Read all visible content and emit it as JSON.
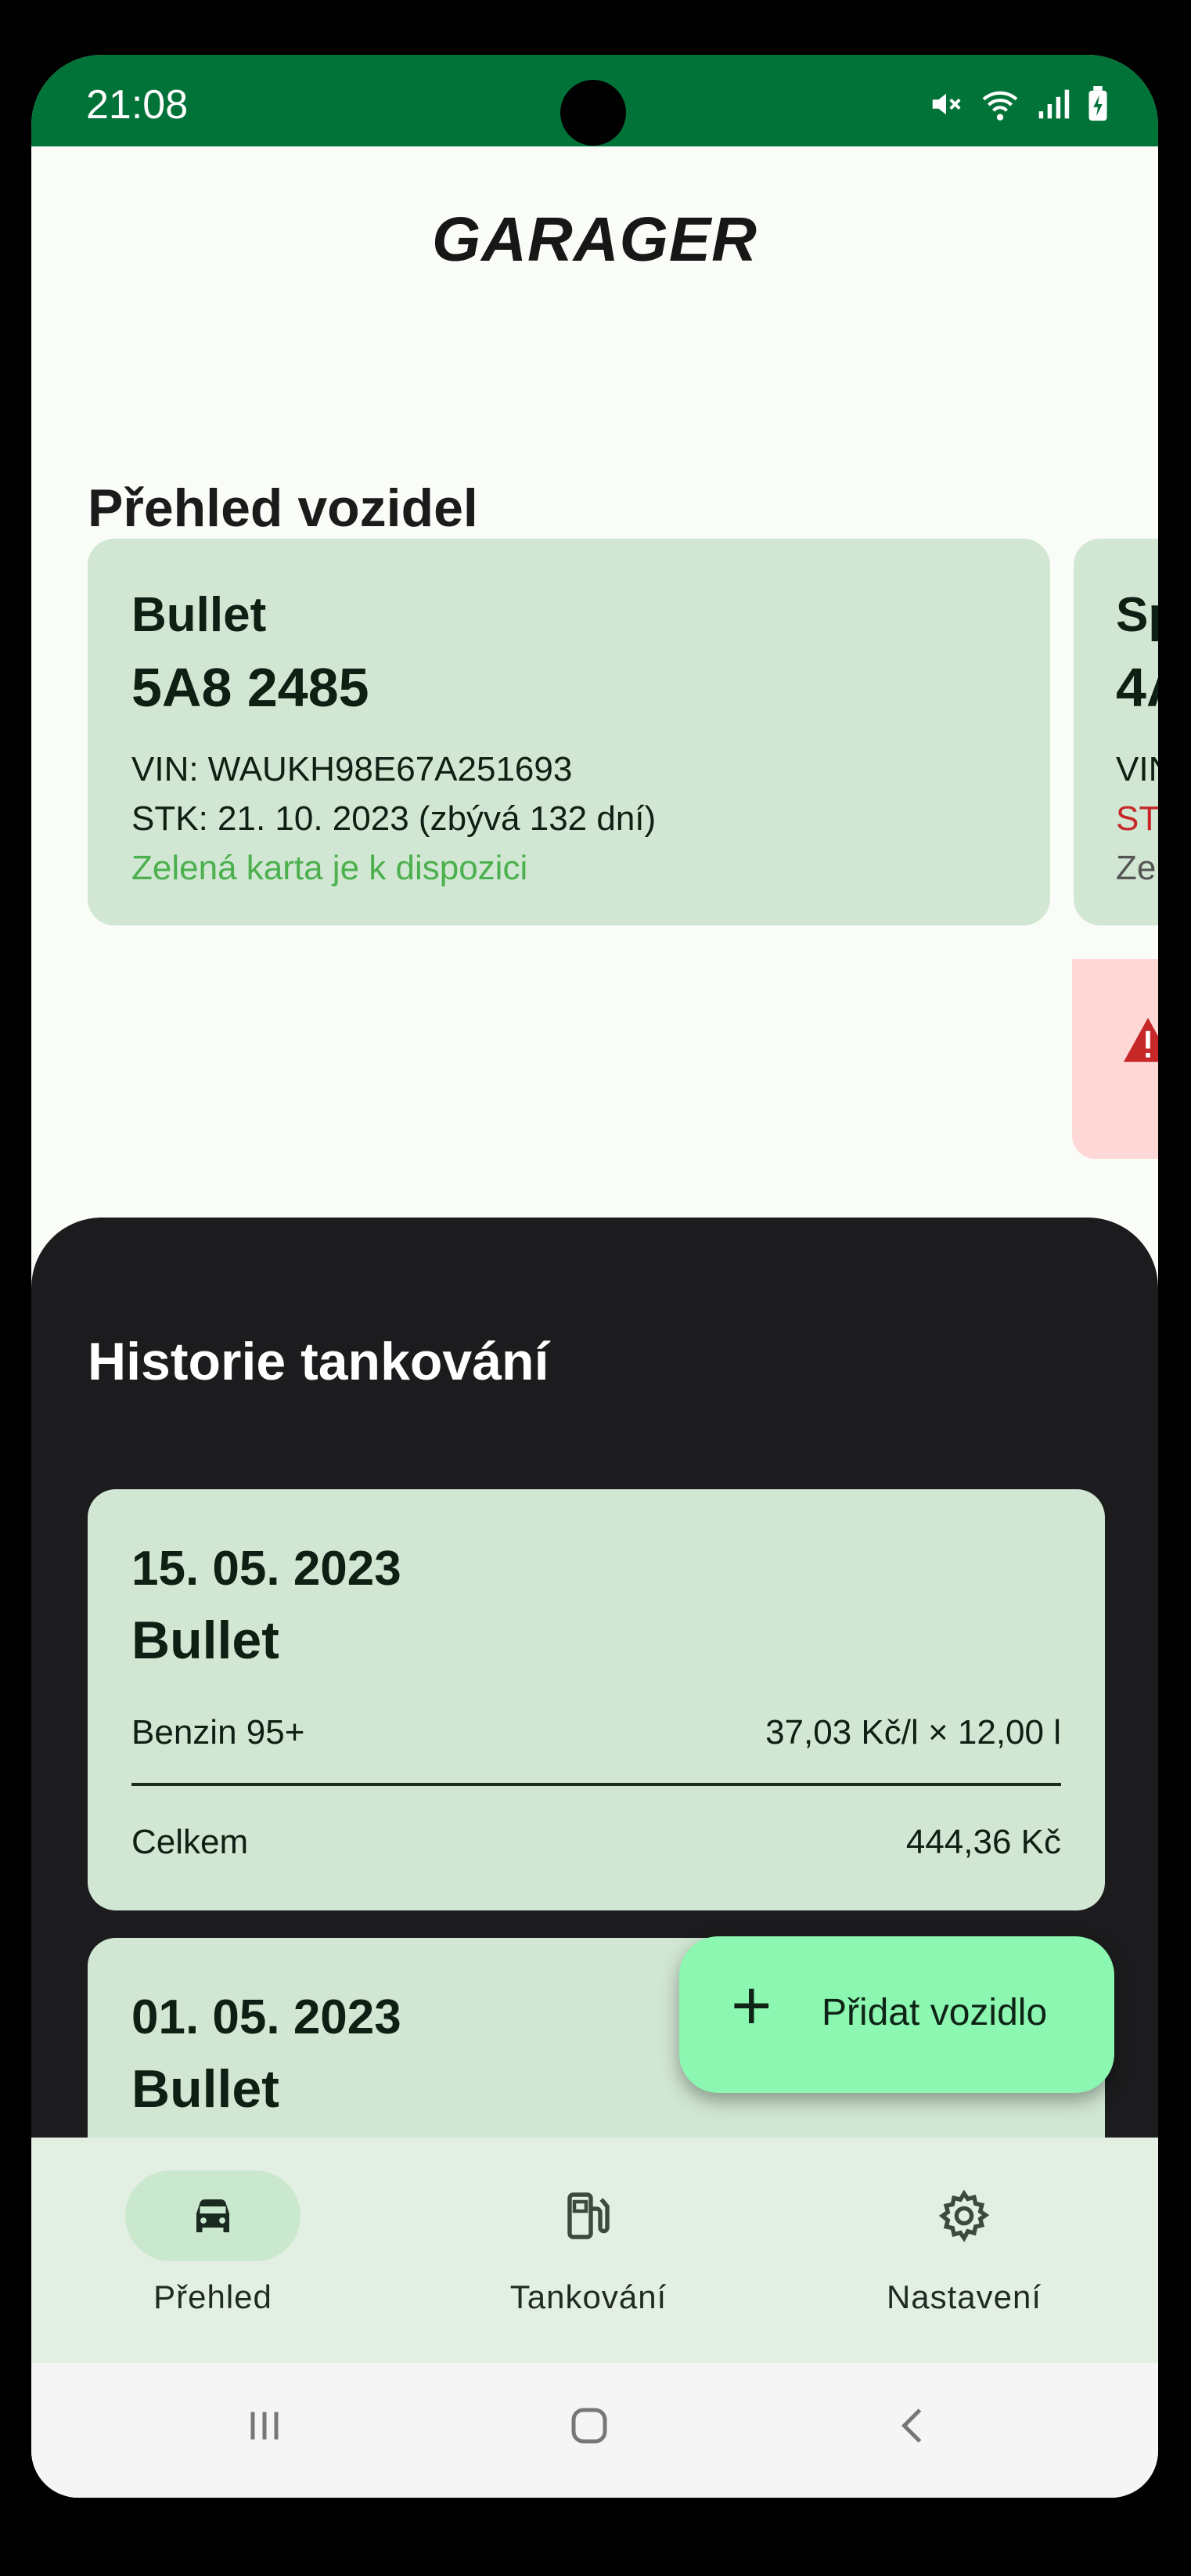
{
  "status": {
    "time": "21:08"
  },
  "app": {
    "title": "GARAGER"
  },
  "vehicles": {
    "title": "Přehled vozidel",
    "cards": [
      {
        "name": "Bullet",
        "plate": "5A8 2485",
        "vin": "VIN: WAUKH98E67A251693",
        "stk": "STK: 21. 10. 2023 (zbývá 132 dní)",
        "green_card": "Zelená karta je k dispozici"
      },
      {
        "name": "Sp",
        "plate": "4A",
        "vin": "VIN",
        "stk": "ST",
        "green_card": "Ze"
      }
    ]
  },
  "history": {
    "title": "Historie tankování",
    "entries": [
      {
        "date": "15. 05. 2023",
        "vehicle": "Bullet",
        "fuel": "Benzin 95+",
        "price_calc": "37,03 Kč/l × 12,00 l",
        "total_label": "Celkem",
        "total": "444,36 Kč"
      },
      {
        "date": "01. 05. 2023",
        "vehicle": "Bullet"
      }
    ]
  },
  "fab": {
    "icon": "plus-icon",
    "label": "Přidat vozidlo"
  },
  "nav": [
    {
      "icon": "car-icon",
      "label": "Přehled",
      "active": true
    },
    {
      "icon": "fuel-pump-icon",
      "label": "Tankování",
      "active": false
    },
    {
      "icon": "gear-icon",
      "label": "Nastavení",
      "active": false
    }
  ],
  "colors": {
    "status_bar": "#017339",
    "card_bg": "#d1e7d3",
    "fab_bg": "#8bf7b0",
    "warning": "#c62828"
  }
}
